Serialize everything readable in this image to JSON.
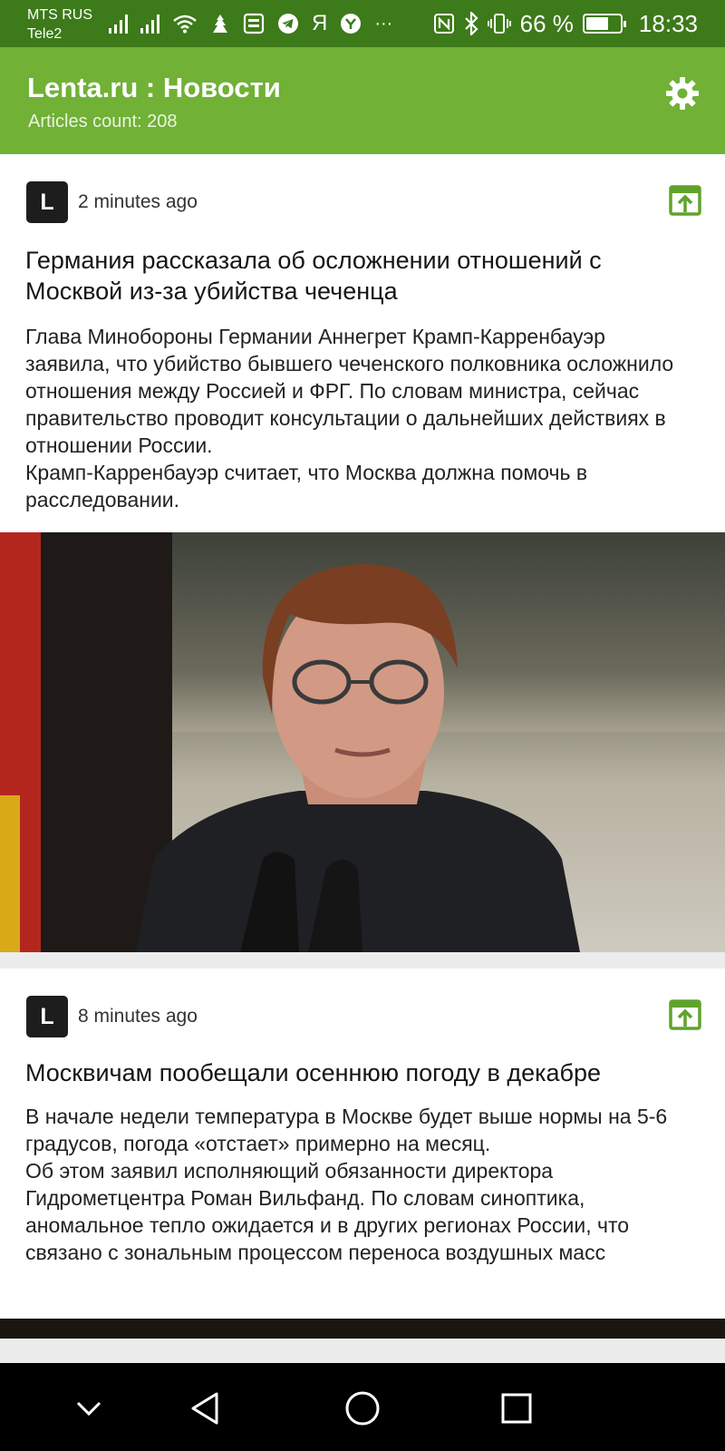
{
  "status_bar": {
    "carrier_1": "MTS RUS",
    "carrier_2": "Tele2",
    "notification_icons": [
      "signal-icon",
      "signal-icon",
      "wifi-icon",
      "app-icon",
      "gallery-icon",
      "telegram-icon",
      "yandex-icon",
      "app-icon"
    ],
    "yandex_glyph": "Я",
    "more_glyph": "···",
    "battery_percent": "66 %",
    "battery_level": 0.66,
    "time": "18:33"
  },
  "app_bar": {
    "title": "Lenta.ru : Новости",
    "subtitle": "Articles count: 208",
    "settings_icon": "gear-icon"
  },
  "articles": [
    {
      "source_logo": "L",
      "time_ago": "2 minutes ago",
      "open_icon": "open-in-new-icon",
      "title": "Германия рассказала об осложнении отношений с Москвой из-за убийства чеченца",
      "summary": "Глава Минобороны Германии Аннегрет Крамп-Карренбауэр заявила, что убийство бывшего чеченского полковника осложнило отношения между Россией и ФРГ. По словам министра, сейчас правительство проводит консультации о дальнейших действиях в отношении России.\nКрамп-Карренбауэр считает, что Москва должна помочь в расследовании."
    },
    {
      "source_logo": "L",
      "time_ago": "8 minutes ago",
      "open_icon": "open-in-new-icon",
      "title": "Москвичам пообещали осеннюю погоду в декабре",
      "summary": "В начале недели температура в Москве будет выше нормы на 5-6 градусов, погода «отстает» примерно на месяц.\nОб этом заявил исполняющий обязанности директора Гидрометцентра Роман Вильфанд. По словам синоптика, аномальное тепло ожидается и в других регионах России, что связано с зональным процессом переноса воздушных масс"
    }
  ],
  "colors": {
    "status_bar": "#3d7a1a",
    "app_bar": "#70b136",
    "accent_icon": "#5fa32c"
  },
  "nav_bar": {
    "buttons": [
      "chevron-down-icon",
      "back-icon",
      "home-icon",
      "recents-icon"
    ]
  }
}
